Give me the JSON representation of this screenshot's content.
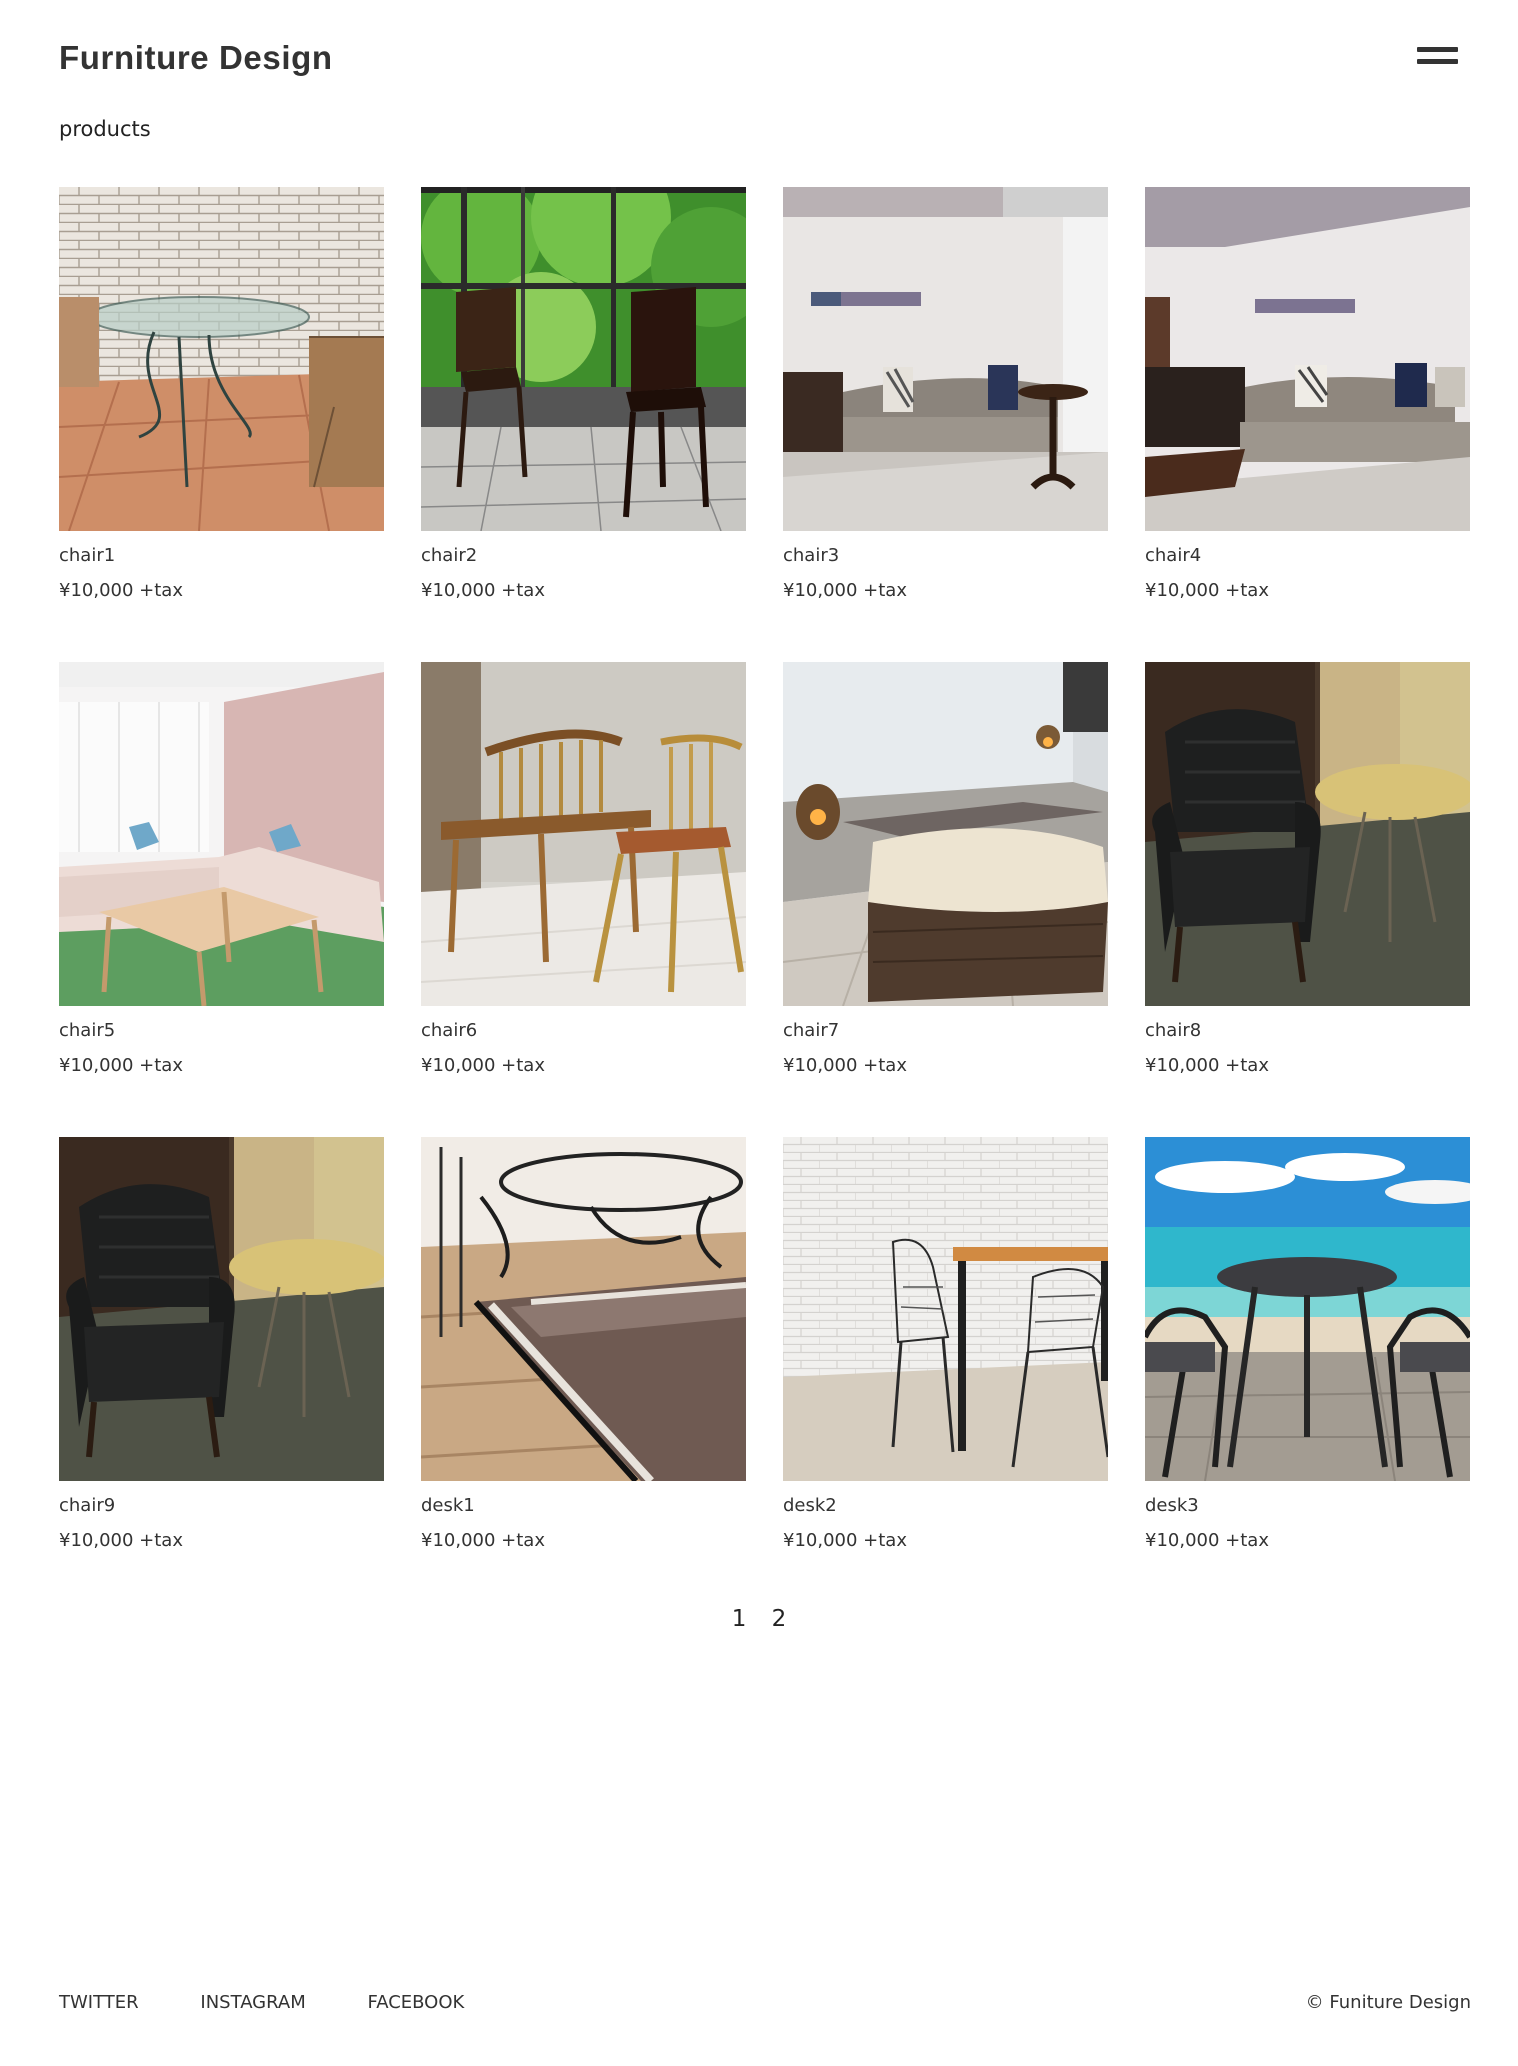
{
  "header": {
    "logo": "Furniture Design",
    "menu_icon": "hamburger-icon"
  },
  "main": {
    "section_title": "products",
    "products": [
      {
        "name": "chair1",
        "price": "¥10,000 +tax",
        "image": "glass-table-brick-wall-photo"
      },
      {
        "name": "chair2",
        "price": "¥10,000 +tax",
        "image": "chairs-forest-window-photo"
      },
      {
        "name": "chair3",
        "price": "¥10,000 +tax",
        "image": "living-room-sofa-photo"
      },
      {
        "name": "chair4",
        "price": "¥10,000 +tax",
        "image": "living-room-sofa-wide-photo"
      },
      {
        "name": "chair5",
        "price": "¥10,000 +tax",
        "image": "pink-room-sofa-photo"
      },
      {
        "name": "chair6",
        "price": "¥10,000 +tax",
        "image": "wooden-chairs-photo"
      },
      {
        "name": "chair7",
        "price": "¥10,000 +tax",
        "image": "ottoman-lantern-photo"
      },
      {
        "name": "chair8",
        "price": "¥10,000 +tax",
        "image": "leather-armchair-photo"
      },
      {
        "name": "chair9",
        "price": "¥10,000 +tax",
        "image": "leather-armchair-photo"
      },
      {
        "name": "desk1",
        "price": "¥10,000 +tax",
        "image": "mosaic-table-photo"
      },
      {
        "name": "desk2",
        "price": "¥10,000 +tax",
        "image": "wire-chairs-desk-photo"
      },
      {
        "name": "desk3",
        "price": "¥10,000 +tax",
        "image": "beach-table-photo"
      }
    ]
  },
  "pagination": {
    "pages": [
      "1",
      "2"
    ]
  },
  "footer": {
    "links": [
      "TWITTER",
      "INSTAGRAM",
      "FACEBOOK"
    ],
    "copyright": "© Funiture Design"
  }
}
